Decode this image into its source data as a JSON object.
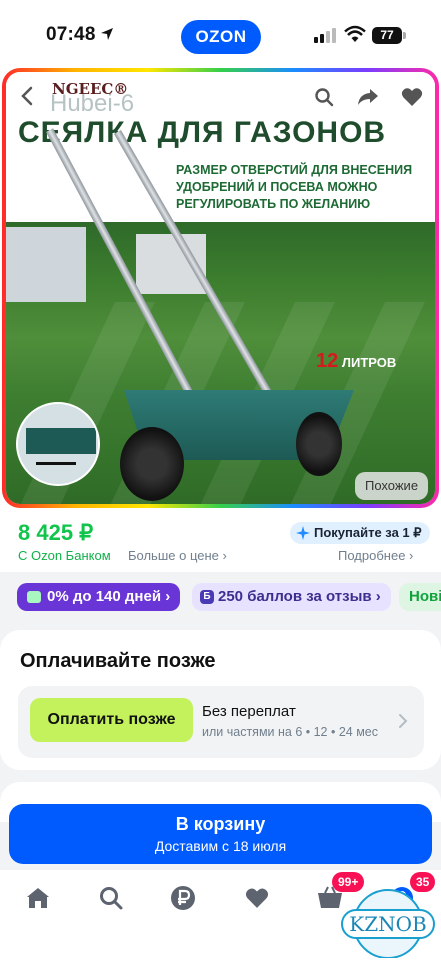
{
  "status": {
    "time": "07:48",
    "brand": "OZON",
    "battery": "77"
  },
  "gallery": {
    "brand_logo": "NGEEC®",
    "brand_name": "Hubei-6",
    "headline": "СЕЯЛКА ДЛЯ ГАЗОНОВ",
    "subtext": "РАЗМЕР ОТВЕРСТИЙ ДЛЯ ВНЕСЕНИЯ УДОБРЕНИЙ И ПОСЕВА МОЖНО РЕГУЛИРОВАТЬ ПО ЖЕЛАНИЮ",
    "liters_number": "12",
    "liters_label": "ЛИТРОВ",
    "similar_label": "Похожие"
  },
  "price": {
    "value": "8 425 ₽",
    "bank_label": "С Ozon Банком",
    "more_link": "Больше о цене",
    "cashback": "Покупайте за 1 ₽",
    "details_link": "Подробнее"
  },
  "chips": [
    {
      "label": "0% до 140 дней"
    },
    {
      "label": "250 баллов за отзыв",
      "icon_text": "Б"
    },
    {
      "label": "Нові"
    }
  ],
  "pay_later": {
    "title": "Оплачивайте позже",
    "button": "Оплатить позже",
    "line1": "Без переплат",
    "line2": "или частями на 6 • 12 • 24 мес"
  },
  "cart": {
    "label": "В корзину",
    "delivery": "Доставим с 18 июля"
  },
  "nav": {
    "cart_badge": "99+",
    "profile_badge": "35",
    "watermark": "KZNOB"
  },
  "colors": {
    "ozon_blue": "#005bff",
    "price_green": "#10c44c",
    "chip_purple": "#6a35d6",
    "paylater_lime": "#c3f25c",
    "badge_pink": "#f91155"
  }
}
